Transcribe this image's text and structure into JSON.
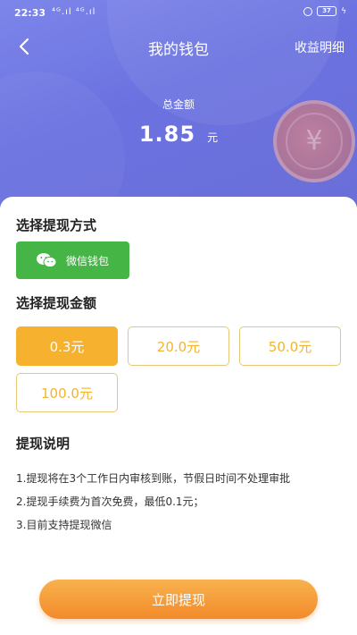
{
  "status_bar": {
    "time": "22:33",
    "signal": "⁴ᴳ.ıl ⁴ᴳ.ıl",
    "battery": "37"
  },
  "nav": {
    "title": "我的钱包",
    "right_label": "收益明细"
  },
  "wallet": {
    "total_label": "总金额",
    "total_value": "1.85",
    "total_unit": "元"
  },
  "withdraw_method": {
    "title": "选择提现方式",
    "option_label": "微信钱包"
  },
  "withdraw_amount": {
    "title": "选择提现金额",
    "options": [
      "0.3元",
      "20.0元",
      "50.0元",
      "100.0元"
    ],
    "selected_index": 0
  },
  "instructions": {
    "title": "提现说明",
    "lines": [
      "1.提现将在3个工作日内审核到账，节假日时间不处理审批",
      "2.提现手续费为首次免费，最低0.1元；",
      "3.目前支持提现微信"
    ]
  },
  "submit_label": "立即提现",
  "colors": {
    "header": "#6b72e0",
    "wechat_green": "#45b545",
    "accent_orange": "#f6b12e",
    "button_orange": "#f28a2a"
  }
}
